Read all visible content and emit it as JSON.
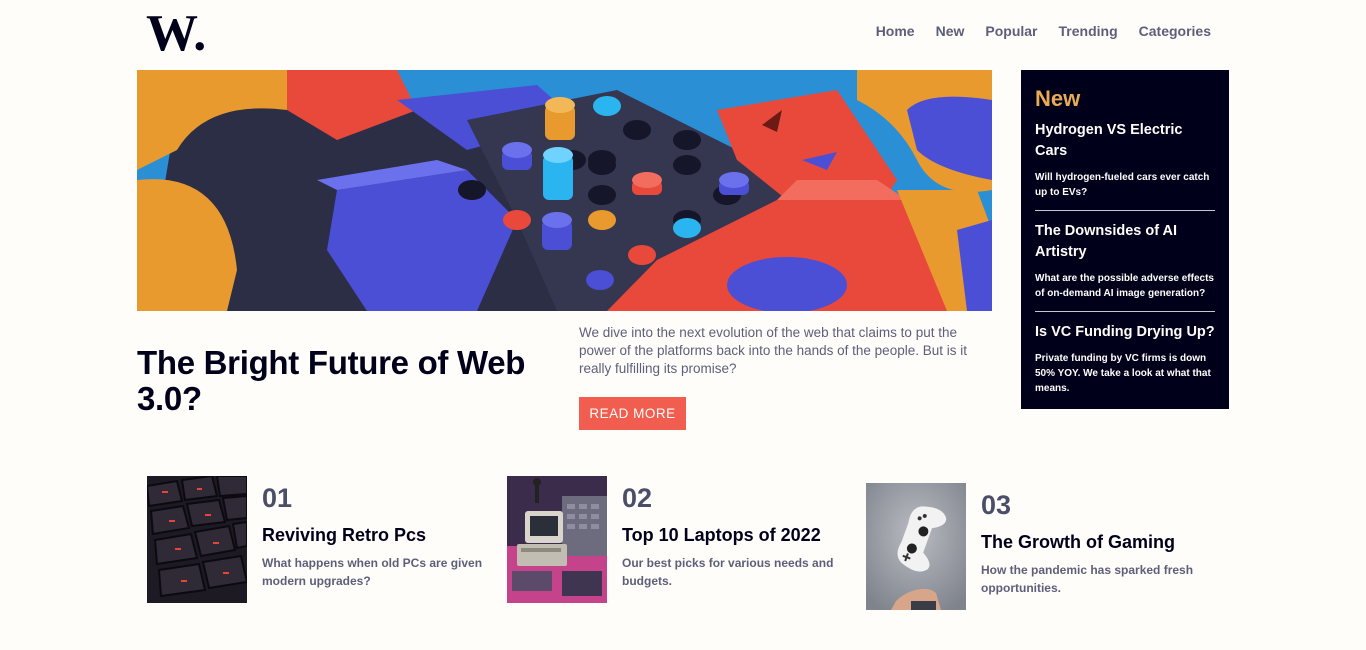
{
  "brand": {
    "logo_text": "W."
  },
  "nav": {
    "items": [
      {
        "label": "Home"
      },
      {
        "label": "New"
      },
      {
        "label": "Popular"
      },
      {
        "label": "Trending"
      },
      {
        "label": "Categories"
      }
    ]
  },
  "hero": {
    "title": "The Bright Future of Web 3.0?",
    "description": "We dive into the next evolution of the web that claims to put the power of the platforms back into the hands of the people. But is it really fulfilling its promise?",
    "cta_label": "READ MORE"
  },
  "new_panel": {
    "heading": "New",
    "items": [
      {
        "title": "Hydrogen VS Electric Cars",
        "summary": "Will hydrogen-fueled cars ever catch up to EVs?"
      },
      {
        "title": "The Downsides of AI Artistry",
        "summary": "What are the possible adverse effects of on-demand AI image generation?"
      },
      {
        "title": "Is VC Funding Drying Up?",
        "summary": "Private funding by VC firms is down 50% YOY. We take a look at what that means."
      }
    ]
  },
  "cards": [
    {
      "number": "01",
      "title": "Reviving Retro Pcs",
      "description": "What happens when old PCs are given modern upgrades?"
    },
    {
      "number": "02",
      "title": "Top 10 Laptops of 2022",
      "description": "Our best picks for various needs and budgets."
    },
    {
      "number": "03",
      "title": "The Growth of Gaming",
      "description": "How the pandemic has sparked fresh opportunities."
    }
  ],
  "colors": {
    "accent": "#f15e50",
    "dark": "#00001a",
    "highlight": "#e9ab53",
    "muted": "#5d5f79",
    "background": "#fffdfa"
  }
}
